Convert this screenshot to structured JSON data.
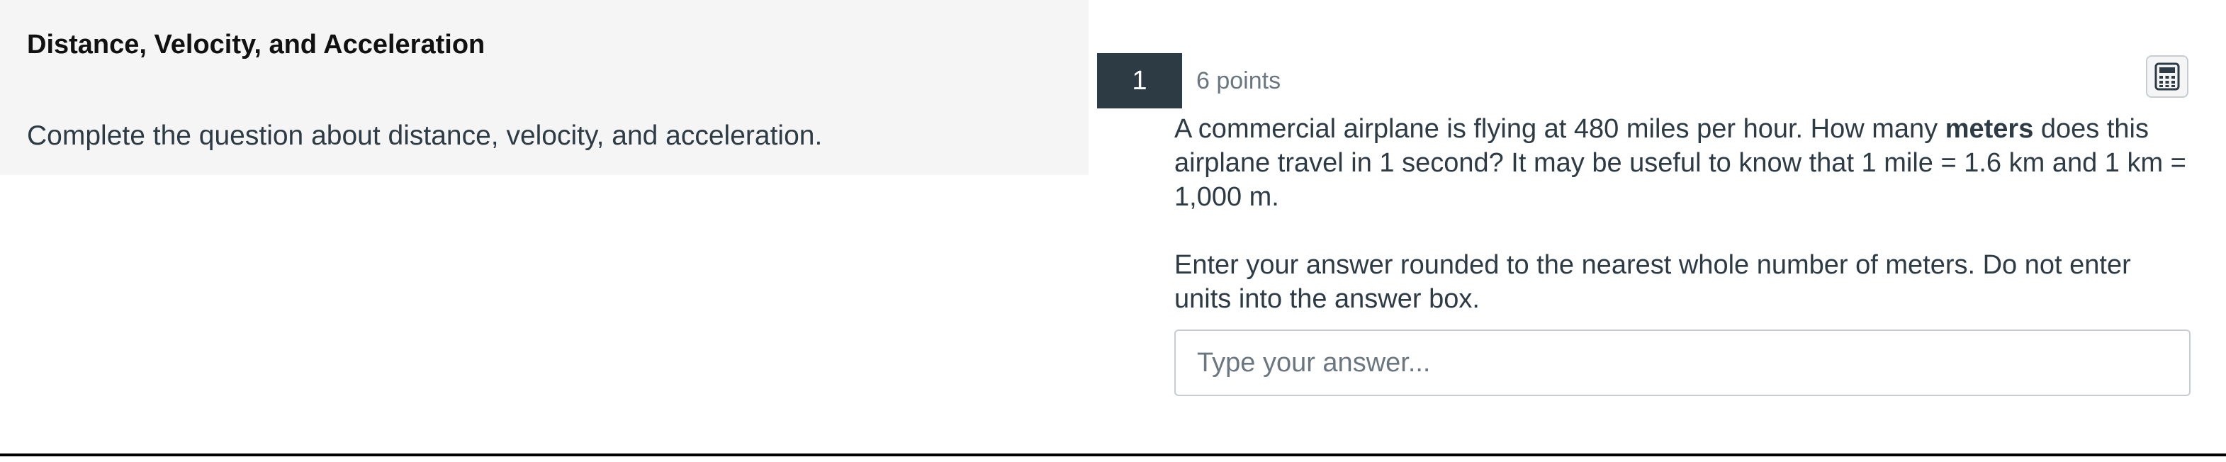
{
  "intro": {
    "title": "Distance, Velocity, and Acceleration",
    "description": "Complete the question about distance, velocity, and acceleration."
  },
  "question": {
    "number": "1",
    "points": "6 points",
    "text_part1": "A commercial airplane is flying at 480 miles per hour. How many ",
    "text_bold": "meters",
    "text_part2": " does this airplane travel in 1 second? It may be useful to know that 1 mile = 1.6 km and 1 km = 1,000 m.",
    "instruction": "Enter your answer rounded to the nearest whole number of meters. Do not enter units into the answer box.",
    "answer_value": "",
    "answer_placeholder": "Type your answer..."
  },
  "icons": {
    "calculator": "calculator-icon"
  },
  "colors": {
    "question_number_bg": "#2d3b45",
    "left_panel_bg": "#f5f5f5",
    "text": "#2d3b45",
    "muted_text": "#6b7780",
    "border": "#c7cdd1"
  }
}
